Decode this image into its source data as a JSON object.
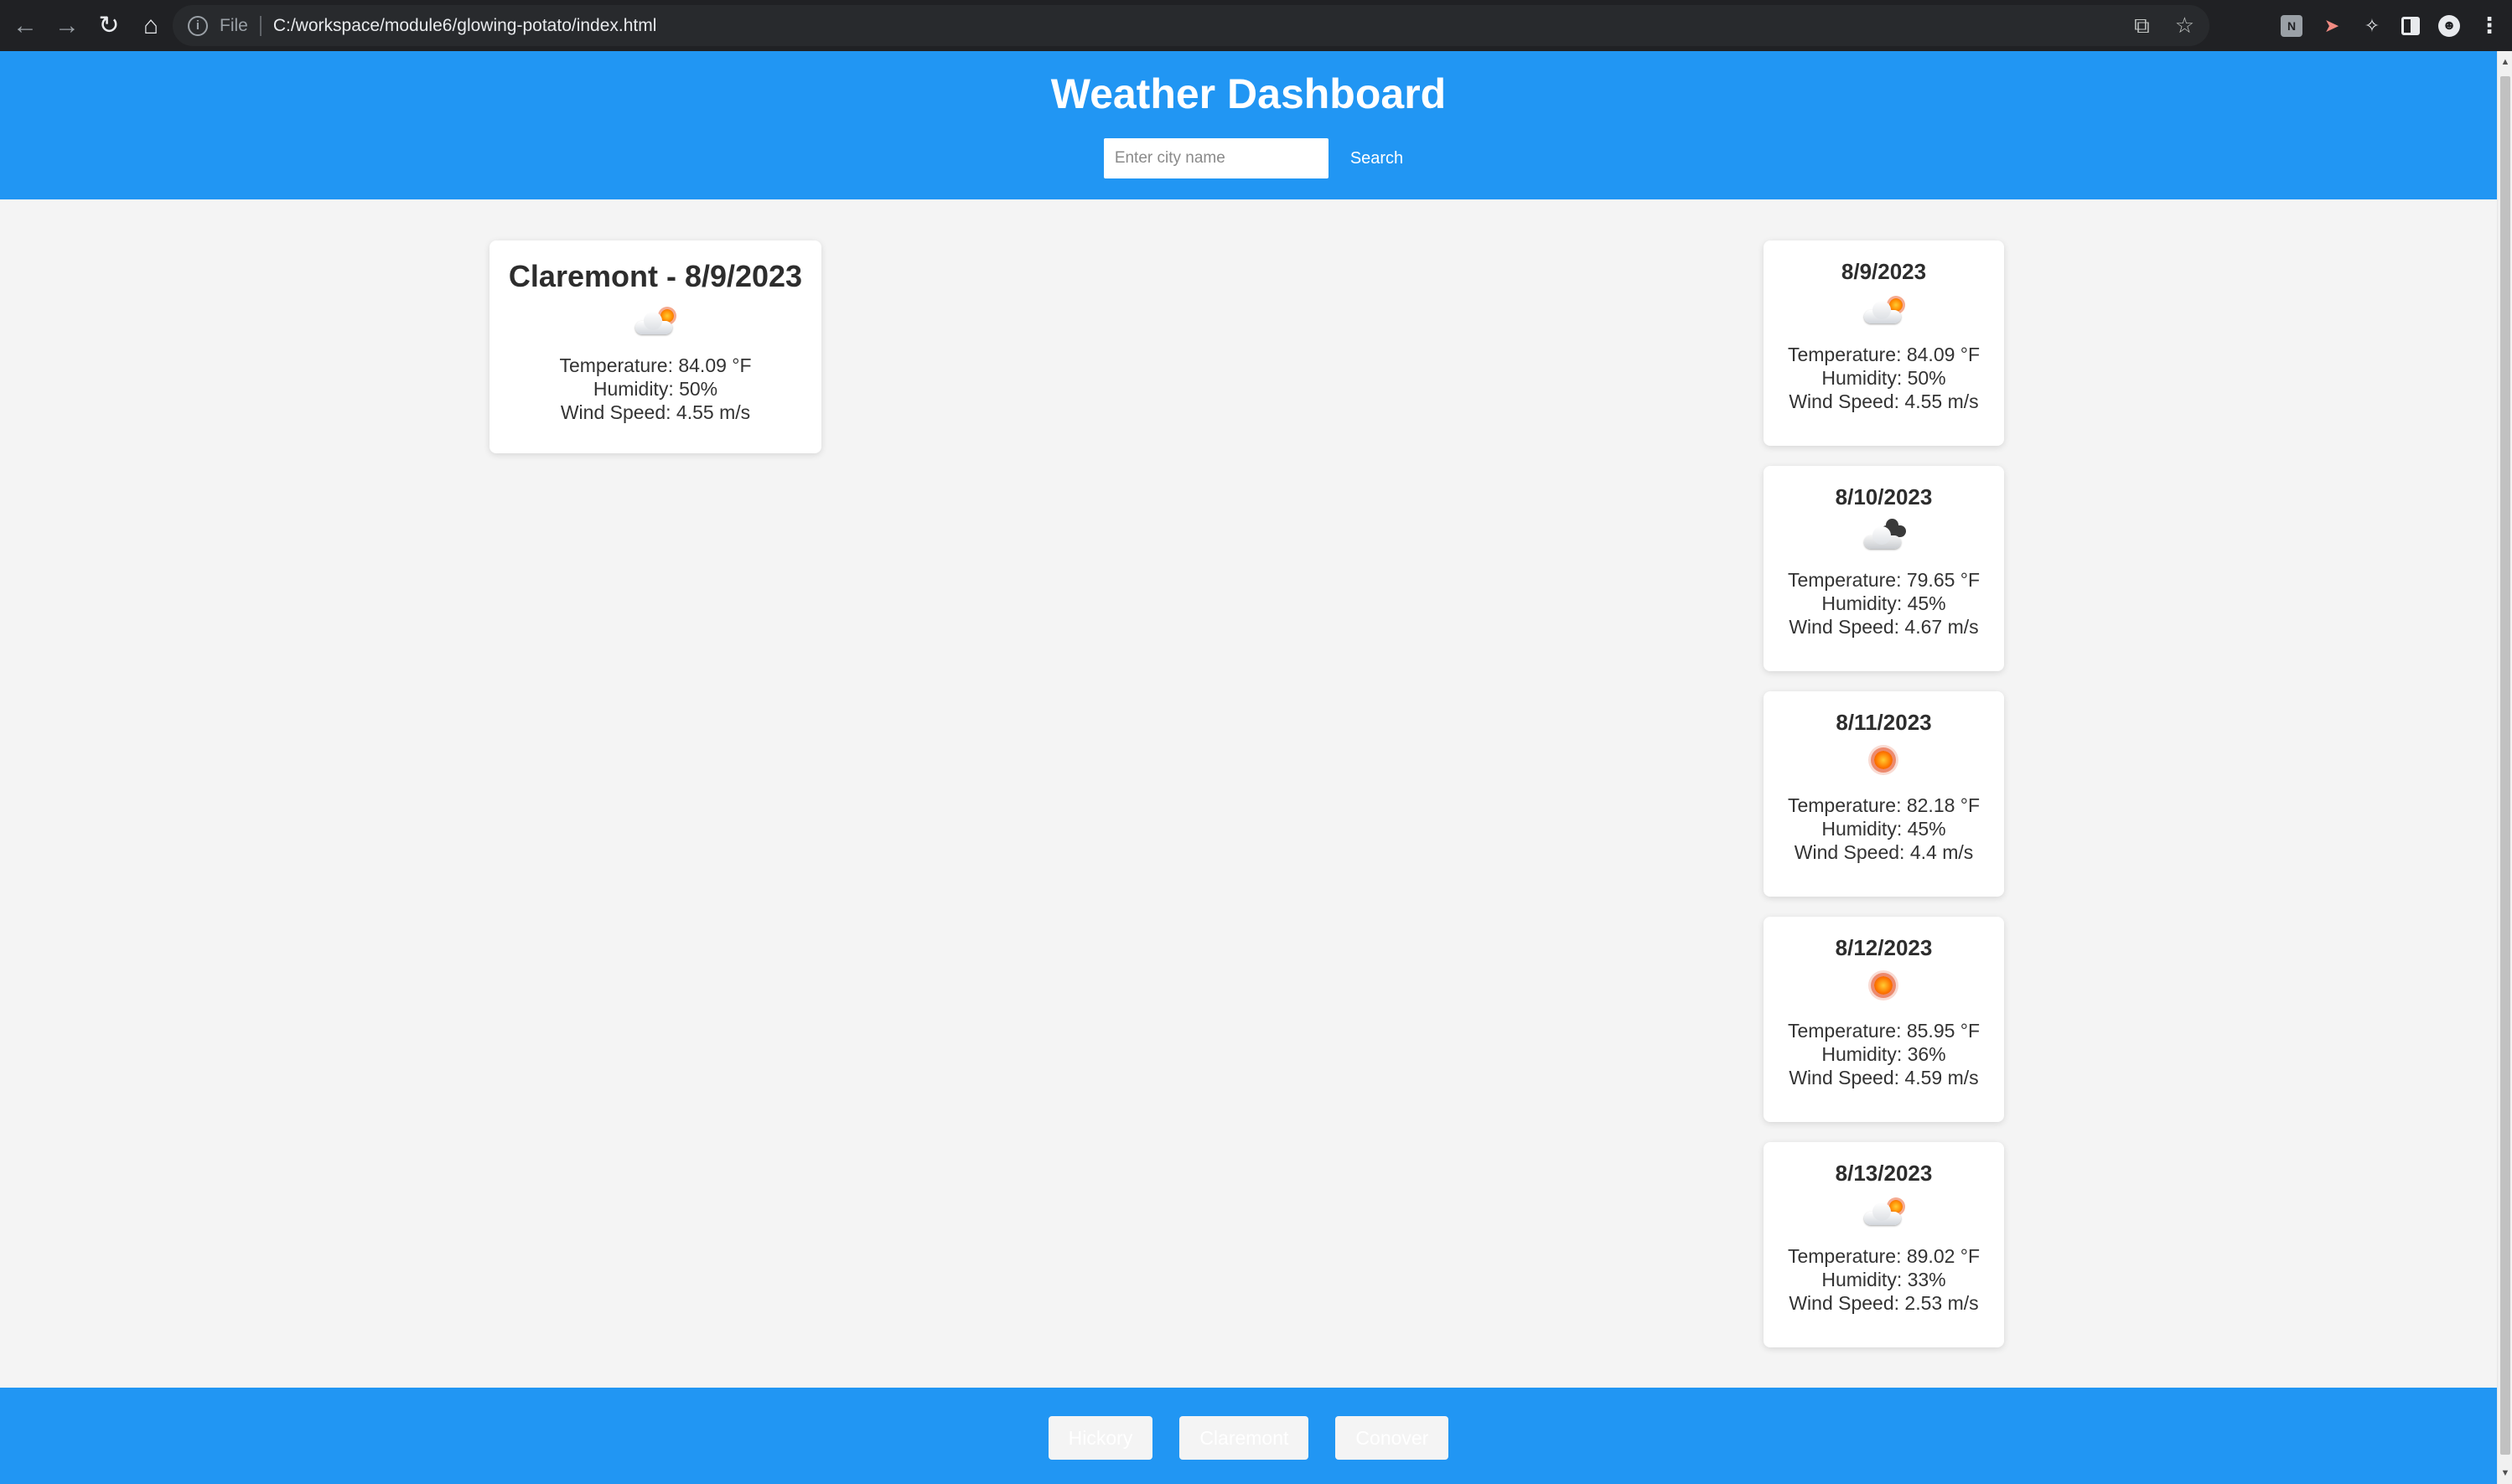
{
  "browser": {
    "back_icon": "arrow-left-icon",
    "forward_icon": "arrow-right-icon",
    "reload_icon": "reload-icon",
    "home_icon": "home-icon",
    "info_icon": "info-icon",
    "scheme_label": "File",
    "url": "C:/workspace/module6/glowing-potato/index.html",
    "extensions": [
      "share-icon",
      "star-icon",
      "extension-n-icon",
      "extension-red-icon",
      "puzzle-icon",
      "side-panel-icon",
      "avatar-icon",
      "menu-icon"
    ]
  },
  "header": {
    "title": "Weather Dashboard",
    "search_placeholder": "Enter city name",
    "search_value": "",
    "search_label": "Search",
    "bg_color": "#2196f3"
  },
  "current": {
    "title": "Claremont - 8/9/2023",
    "icon": "partly-cloudy-icon",
    "temperature": "Temperature: 84.09 °F",
    "humidity": "Humidity: 50%",
    "wind": "Wind Speed: 4.55 m/s"
  },
  "forecast": [
    {
      "date": "8/9/2023",
      "icon": "partly-cloudy-icon",
      "temperature": "Temperature: 84.09 °F",
      "humidity": "Humidity: 50%",
      "wind": "Wind Speed: 4.55 m/s"
    },
    {
      "date": "8/10/2023",
      "icon": "broken-clouds-icon",
      "temperature": "Temperature: 79.65 °F",
      "humidity": "Humidity: 45%",
      "wind": "Wind Speed: 4.67 m/s"
    },
    {
      "date": "8/11/2023",
      "icon": "clear-sun-icon",
      "temperature": "Temperature: 82.18 °F",
      "humidity": "Humidity: 45%",
      "wind": "Wind Speed: 4.4 m/s"
    },
    {
      "date": "8/12/2023",
      "icon": "clear-sun-icon",
      "temperature": "Temperature: 85.95 °F",
      "humidity": "Humidity: 36%",
      "wind": "Wind Speed: 4.59 m/s"
    },
    {
      "date": "8/13/2023",
      "icon": "partly-cloudy-icon",
      "temperature": "Temperature: 89.02 °F",
      "humidity": "Humidity: 33%",
      "wind": "Wind Speed: 2.53 m/s"
    }
  ],
  "history": [
    "Hickory",
    "Claremont",
    "Conover"
  ]
}
